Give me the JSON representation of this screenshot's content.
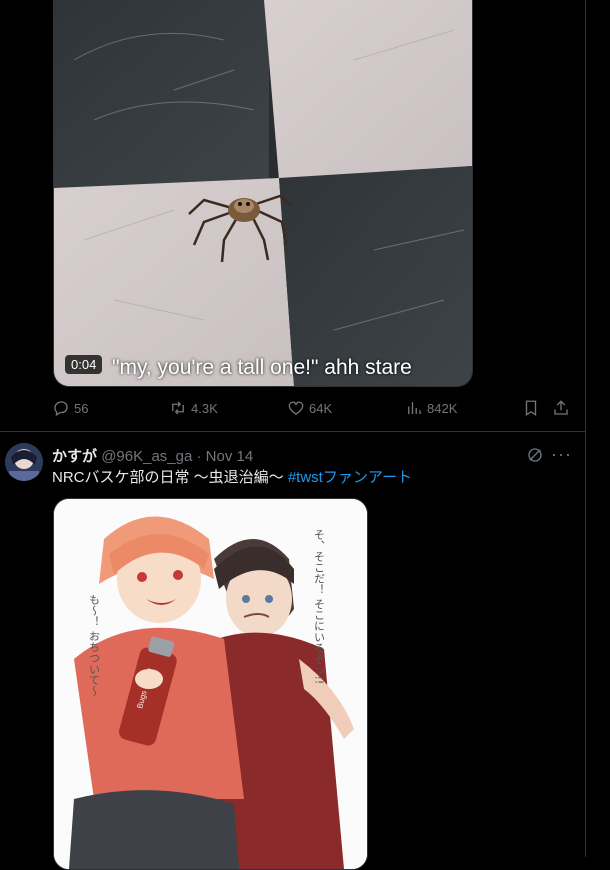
{
  "tweet1": {
    "video_time": "0:04",
    "caption": "\"my, you're a tall one!\" ahh stare",
    "stats": {
      "replies": "56",
      "reposts": "4.3K",
      "likes": "64K",
      "views": "842K"
    }
  },
  "tweet2": {
    "display_name": "かすが",
    "handle": "@96K_as_ga",
    "separator": "·",
    "date": "Nov 14",
    "text": "NRCバスケ部の日常 〜虫退治編〜 ",
    "hashtag": "#twstファンアート",
    "art_text": {
      "bubble_left": "も〜！ おちついて〜",
      "bubble_right": "そ、そこだ！ そこにいるぞっ!!",
      "can_label": "Bugs Spray"
    }
  },
  "icons": [
    "reply-icon",
    "retweet-icon",
    "like-icon",
    "views-icon",
    "bookmark-icon",
    "share-icon",
    "grok-icon",
    "more-icon"
  ],
  "colors": {
    "background": "#000000",
    "text": "#e7e9ea",
    "muted": "#71767b",
    "link": "#1d9bf0",
    "border": "#2f3336"
  }
}
